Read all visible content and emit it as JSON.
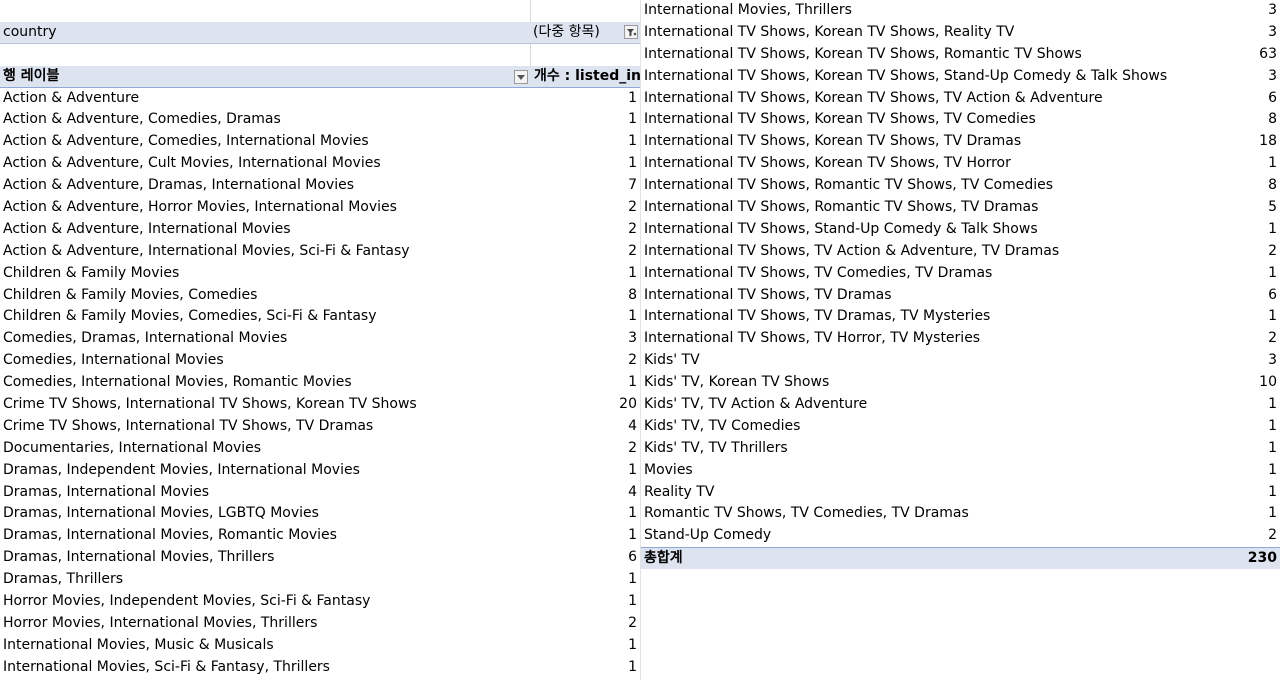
{
  "pivot": {
    "filter_field": "country",
    "filter_value": "(다중 항목)",
    "row_label_header": "행 레이블",
    "value_header": "개수 : listed_in",
    "total_label": "총합계",
    "total_value": "230"
  },
  "left_rows": [
    {
      "label": "Action & Adventure",
      "value": "1"
    },
    {
      "label": "Action & Adventure, Comedies, Dramas",
      "value": "1"
    },
    {
      "label": "Action & Adventure, Comedies, International Movies",
      "value": "1"
    },
    {
      "label": "Action & Adventure, Cult Movies, International Movies",
      "value": "1"
    },
    {
      "label": "Action & Adventure, Dramas, International Movies",
      "value": "7"
    },
    {
      "label": "Action & Adventure, Horror Movies, International Movies",
      "value": "2"
    },
    {
      "label": "Action & Adventure, International Movies",
      "value": "2"
    },
    {
      "label": "Action & Adventure, International Movies, Sci-Fi & Fantasy",
      "value": "2"
    },
    {
      "label": "Children & Family Movies",
      "value": "1"
    },
    {
      "label": "Children & Family Movies, Comedies",
      "value": "8"
    },
    {
      "label": "Children & Family Movies, Comedies, Sci-Fi & Fantasy",
      "value": "1"
    },
    {
      "label": "Comedies, Dramas, International Movies",
      "value": "3"
    },
    {
      "label": "Comedies, International Movies",
      "value": "2"
    },
    {
      "label": "Comedies, International Movies, Romantic Movies",
      "value": "1"
    },
    {
      "label": "Crime TV Shows, International TV Shows, Korean TV Shows",
      "value": "20"
    },
    {
      "label": "Crime TV Shows, International TV Shows, TV Dramas",
      "value": "4"
    },
    {
      "label": "Documentaries, International Movies",
      "value": "2"
    },
    {
      "label": "Dramas, Independent Movies, International Movies",
      "value": "1"
    },
    {
      "label": "Dramas, International Movies",
      "value": "4"
    },
    {
      "label": "Dramas, International Movies, LGBTQ Movies",
      "value": "1"
    },
    {
      "label": "Dramas, International Movies, Romantic Movies",
      "value": "1"
    },
    {
      "label": "Dramas, International Movies, Thrillers",
      "value": "6"
    },
    {
      "label": "Dramas, Thrillers",
      "value": "1"
    },
    {
      "label": "Horror Movies, Independent Movies, Sci-Fi & Fantasy",
      "value": "1"
    },
    {
      "label": "Horror Movies, International Movies, Thrillers",
      "value": "2"
    },
    {
      "label": "International Movies, Music & Musicals",
      "value": "1"
    },
    {
      "label": "International Movies, Sci-Fi & Fantasy, Thrillers",
      "value": "1"
    }
  ],
  "right_rows": [
    {
      "label": "International Movies, Thrillers",
      "value": "3"
    },
    {
      "label": "International TV Shows, Korean TV Shows, Reality TV",
      "value": "3"
    },
    {
      "label": "International TV Shows, Korean TV Shows, Romantic TV Shows",
      "value": "63"
    },
    {
      "label": "International TV Shows, Korean TV Shows, Stand-Up Comedy & Talk Shows",
      "value": "3"
    },
    {
      "label": "International TV Shows, Korean TV Shows, TV Action & Adventure",
      "value": "6"
    },
    {
      "label": "International TV Shows, Korean TV Shows, TV Comedies",
      "value": "8"
    },
    {
      "label": "International TV Shows, Korean TV Shows, TV Dramas",
      "value": "18"
    },
    {
      "label": "International TV Shows, Korean TV Shows, TV Horror",
      "value": "1"
    },
    {
      "label": "International TV Shows, Romantic TV Shows, TV Comedies",
      "value": "8"
    },
    {
      "label": "International TV Shows, Romantic TV Shows, TV Dramas",
      "value": "5"
    },
    {
      "label": "International TV Shows, Stand-Up Comedy & Talk Shows",
      "value": "1"
    },
    {
      "label": "International TV Shows, TV Action & Adventure, TV Dramas",
      "value": "2"
    },
    {
      "label": "International TV Shows, TV Comedies, TV Dramas",
      "value": "1"
    },
    {
      "label": "International TV Shows, TV Dramas",
      "value": "6"
    },
    {
      "label": "International TV Shows, TV Dramas, TV Mysteries",
      "value": "1"
    },
    {
      "label": "International TV Shows, TV Horror, TV Mysteries",
      "value": "2"
    },
    {
      "label": "Kids' TV",
      "value": "3"
    },
    {
      "label": "Kids' TV, Korean TV Shows",
      "value": "10"
    },
    {
      "label": "Kids' TV, TV Action & Adventure",
      "value": "1"
    },
    {
      "label": "Kids' TV, TV Comedies",
      "value": "1"
    },
    {
      "label": "Kids' TV, TV Thrillers",
      "value": "1"
    },
    {
      "label": "Movies",
      "value": "1"
    },
    {
      "label": "Reality TV",
      "value": "1"
    },
    {
      "label": "Romantic TV Shows, TV Comedies, TV Dramas",
      "value": "1"
    },
    {
      "label": "Stand-Up Comedy",
      "value": "2"
    }
  ]
}
